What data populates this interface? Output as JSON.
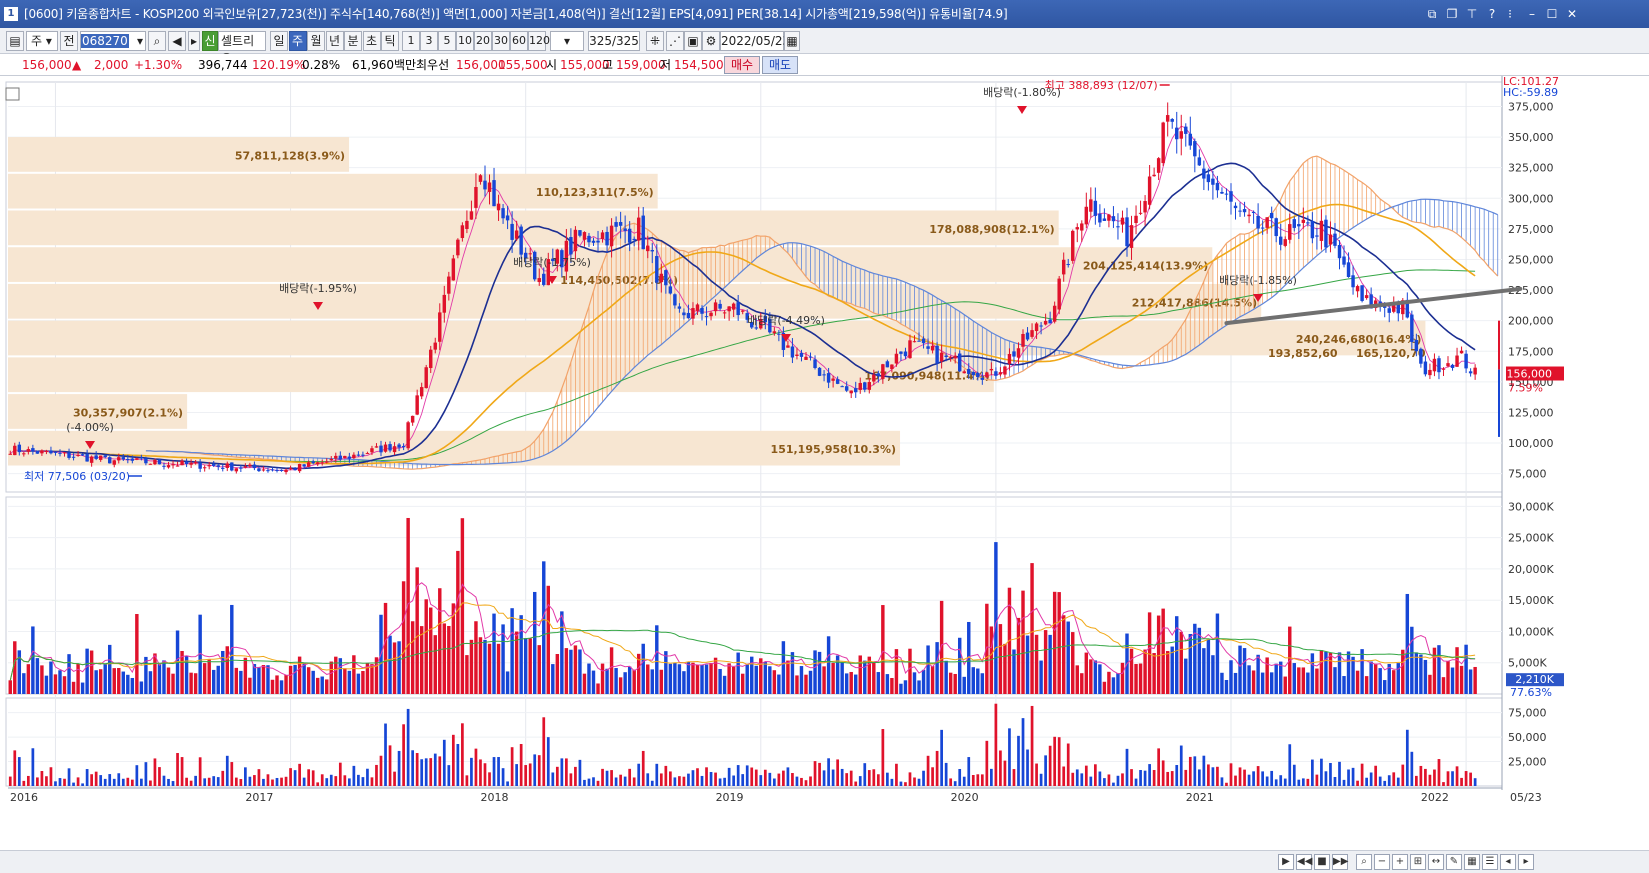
{
  "title_bar": {
    "screen_no": "1",
    "title": "[0600] 키움종합차트 - KOSPI200 외국인보유[27,723(천)] 주식수[140,768(천)] 액면[1,000] 자본금[1,408(억)] 결산[12월] EPS[4,091] PER[38.14] 시가총액[219,598(억)] 유통비율[74.9]"
  },
  "toolbar": {
    "market": "주",
    "prev_label": "전",
    "code": "068270",
    "name_badge": "신",
    "stock_name": "셀트리온",
    "periods": [
      "일",
      "주",
      "월",
      "년",
      "분",
      "초",
      "틱"
    ],
    "active_period": "주",
    "tick_numbers": [
      "1",
      "3",
      "5",
      "10",
      "20",
      "30",
      "60",
      "120"
    ],
    "count": "325/325",
    "date": "2022/05/23"
  },
  "info_bar": {
    "price": "156,000",
    "change": "2,000",
    "change_pct": "+1.30%",
    "volume": "396,744",
    "vol_ratio": "120.19%",
    "turnover": "0.28%",
    "amount": "61,960백만",
    "quote_label": "최우선",
    "best_ask": "156,000",
    "best_bid": "155,500",
    "open_label": "시",
    "open": "155,000",
    "high_label": "고",
    "high": "159,000",
    "low_label": "저",
    "low": "154,500",
    "buy_label": "매수",
    "sell_label": "매도"
  },
  "colors": {
    "up": "#e0122b",
    "down": "#1646d6",
    "ma5": "#e23aa8",
    "ma20": "#1c2f92",
    "ma60": "#f0a818",
    "ma120": "#35a645",
    "cloud_a": "#f2a36a",
    "cloud_b": "#5f86da",
    "volume_profile": "#f7e6d2",
    "trendline": "#707070"
  },
  "chart_data": {
    "type": "candlestick",
    "interval": "weekly",
    "x_axis_labels": [
      "2016",
      "2017",
      "2018",
      "2019",
      "2020",
      "2021",
      "2022",
      "05/23"
    ],
    "price_axis": {
      "ticks": [
        "375,000",
        "350,000",
        "325,000",
        "300,000",
        "275,000",
        "250,000",
        "225,000",
        "200,000",
        "175,000",
        "150,000",
        "125,000",
        "100,000",
        "75,000"
      ],
      "range": [
        60000,
        395000
      ],
      "top_labels": [
        "LC:101.27",
        "HC:-59.89"
      ],
      "current_price": "156,000",
      "current_pct": "7.59%"
    },
    "volume_axis": {
      "ticks": [
        "30,000K",
        "25,000K",
        "20,000K",
        "15,000K",
        "10,000K",
        "5,000K"
      ],
      "range": [
        0,
        31500
      ],
      "current": "2,210K",
      "current_pct": "77.63%"
    },
    "indicator_axis": {
      "ticks": [
        "75,000",
        "50,000",
        "25,000"
      ],
      "range": [
        0,
        90000
      ]
    },
    "annotations": {
      "high": "최고 388,893 (12/07)",
      "low": "최저 77,506 (03/20)",
      "dividends": [
        "(-4.00%)",
        "배당락(-1.95%)",
        "배당락(-1.75%)",
        "배당락(-4.49%)",
        "배당락(-1.80%)",
        "배당락(-1.85%)"
      ]
    },
    "volume_profile": [
      {
        "price_low": 320000,
        "price_high": 350000,
        "label": "57,811,128(3.9%)"
      },
      {
        "price_low": 290000,
        "price_high": 320000,
        "label": "110,123,311(7.5%)"
      },
      {
        "price_low": 260000,
        "price_high": 290000,
        "label": "178,088,908(12.1%)"
      },
      {
        "price_low": 230000,
        "price_high": 260000,
        "label": "204,125,414(13.9%)"
      },
      {
        "price_low": 200000,
        "price_high": 230000,
        "label": "212,417,886(14.5%)"
      },
      {
        "price_low": 170000,
        "price_high": 200000,
        "label": "240,246,680(16.4%)"
      },
      {
        "price_low": 140000,
        "price_high": 170000,
        "label": "167,090,948(11.4%)"
      },
      {
        "price_low": 110000,
        "price_high": 140000,
        "label": "30,357,907(2.1%)"
      },
      {
        "price_low": 80000,
        "price_high": 110000,
        "label": "151,195,958(10.3%)"
      }
    ],
    "extra_labels": [
      "114,450,502(7.8%)",
      "193,852,60",
      "165,120,70"
    ],
    "keypoints": [
      {
        "date": "2016-01",
        "price": 95000
      },
      {
        "date": "2016-06",
        "price": 86000
      },
      {
        "date": "2017-03",
        "price": 78000
      },
      {
        "date": "2017-06",
        "price": 88000
      },
      {
        "date": "2017-09",
        "price": 100000
      },
      {
        "date": "2017-11",
        "price": 200000
      },
      {
        "date": "2018-01",
        "price": 330000
      },
      {
        "date": "2018-02",
        "price": 290000
      },
      {
        "date": "2018-04",
        "price": 235000
      },
      {
        "date": "2018-06",
        "price": 268000
      },
      {
        "date": "2018-09",
        "price": 275000
      },
      {
        "date": "2018-11",
        "price": 205000
      },
      {
        "date": "2019-02",
        "price": 210000
      },
      {
        "date": "2019-05",
        "price": 175000
      },
      {
        "date": "2019-08",
        "price": 140000
      },
      {
        "date": "2019-11",
        "price": 180000
      },
      {
        "date": "2020-03",
        "price": 155000
      },
      {
        "date": "2020-06",
        "price": 205000
      },
      {
        "date": "2020-08",
        "price": 300000
      },
      {
        "date": "2020-10",
        "price": 270000
      },
      {
        "date": "2020-12",
        "price": 360000
      },
      {
        "date": "2021-02",
        "price": 320000
      },
      {
        "date": "2021-04",
        "price": 280000
      },
      {
        "date": "2021-06",
        "price": 270000
      },
      {
        "date": "2021-08",
        "price": 275000
      },
      {
        "date": "2021-10",
        "price": 215000
      },
      {
        "date": "2021-12",
        "price": 210000
      },
      {
        "date": "2022-01",
        "price": 160000
      },
      {
        "date": "2022-03",
        "price": 170000
      },
      {
        "date": "2022-05",
        "price": 156000
      }
    ]
  }
}
